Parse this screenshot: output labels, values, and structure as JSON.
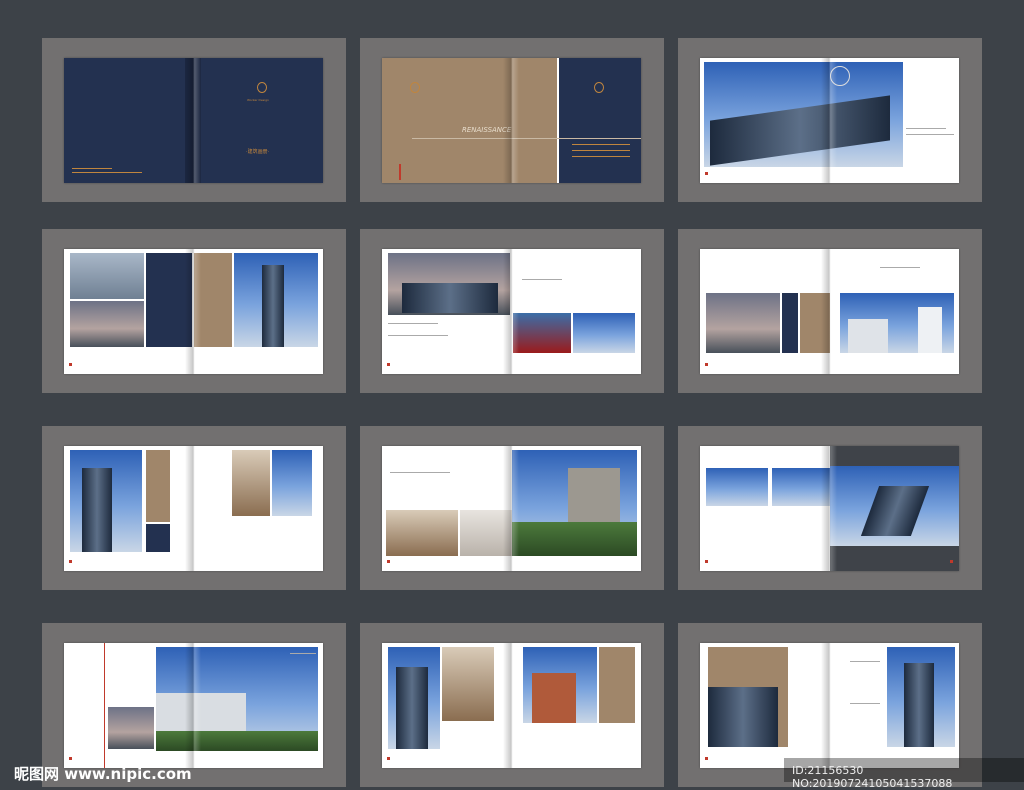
{
  "cover": {
    "brand_line": "Worker Design",
    "title": "·建筑画册·"
  },
  "spread2": {
    "renaissance": "RENAISSANCE"
  },
  "watermark": {
    "site": "昵图网 www.nipic.com",
    "id": "ID:21156530 NO:20190724105041537088"
  }
}
